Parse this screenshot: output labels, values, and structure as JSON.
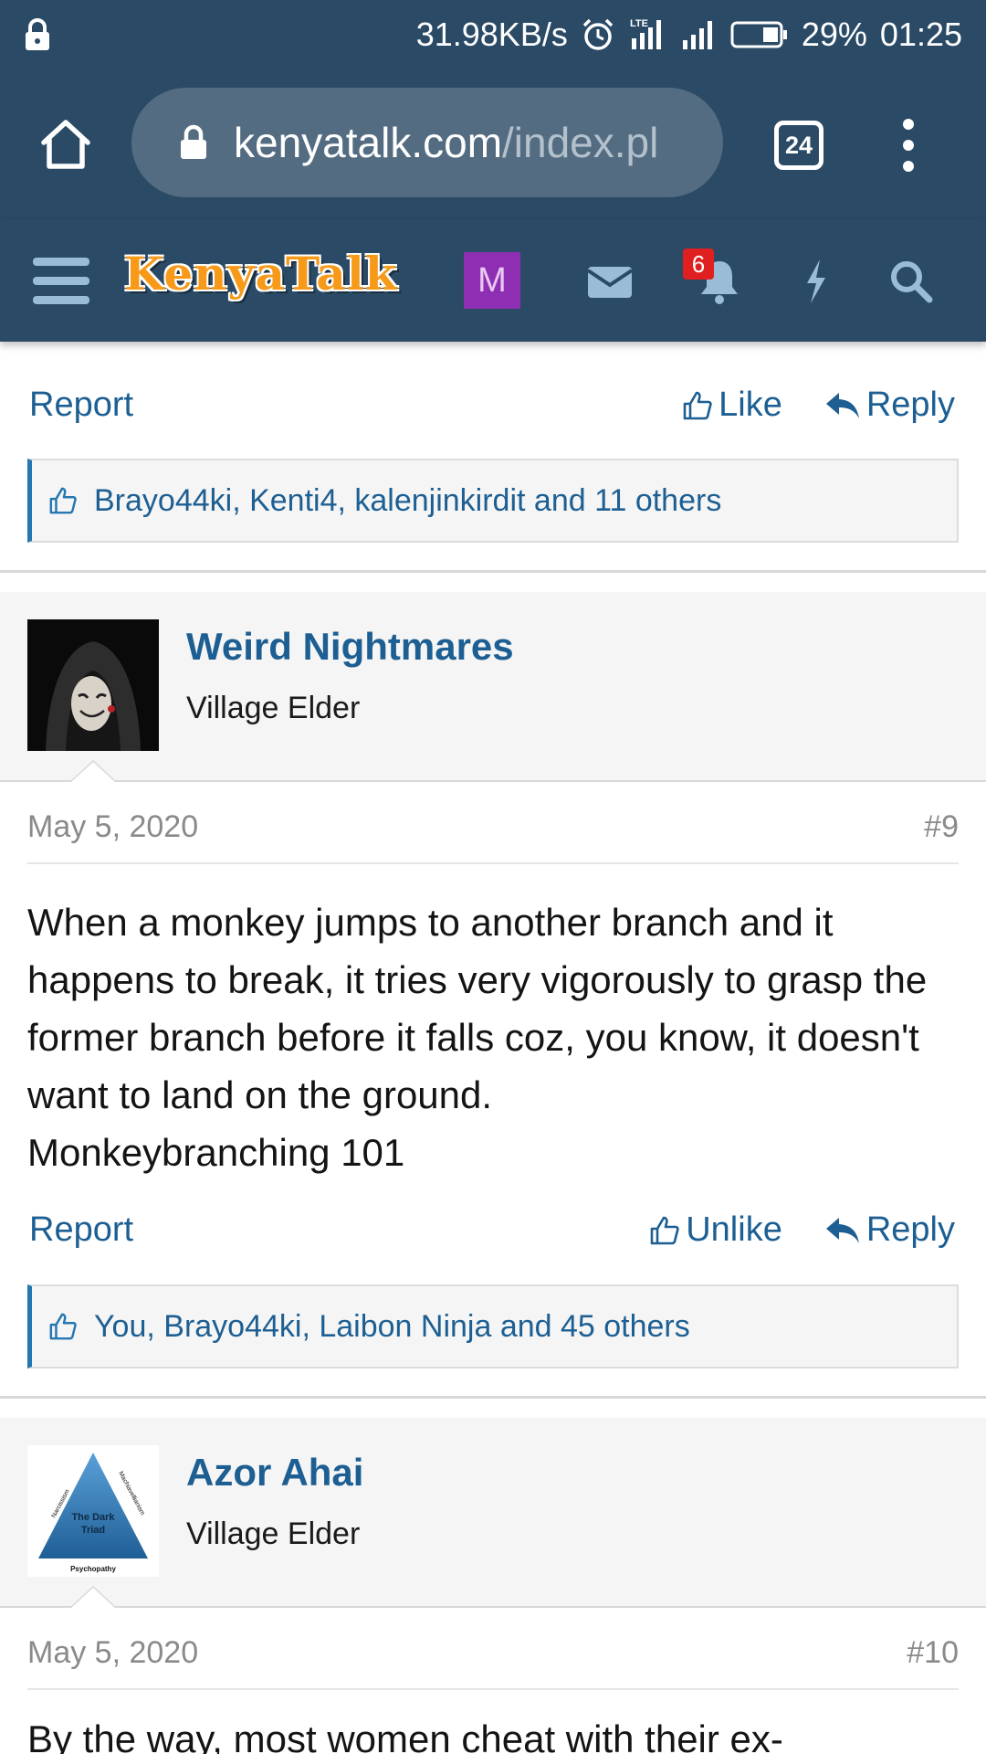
{
  "status_bar": {
    "speed": "31.98KB/s",
    "network": "LTE",
    "battery": "29%",
    "time": "01:25"
  },
  "browser": {
    "url_host": "kenyatalk.com",
    "url_path": "/index.pl",
    "tab_count": "24"
  },
  "site_nav": {
    "logo": "KenyaTalk",
    "avatar_letter": "M",
    "notification_count": "6"
  },
  "post_8_footer": {
    "report": "Report",
    "like": "Like",
    "reply": "Reply",
    "likes_text": "Brayo44ki, Kenti4, kalenjinkirdit and 11 others"
  },
  "post_9": {
    "username": "Weird Nightmares",
    "user_title": "Village Elder",
    "date": "May 5, 2020",
    "number": "#9",
    "body": "When a monkey jumps to another branch and it happens to break, it tries very vigorously to grasp the former branch before it falls coz, you know, it doesn't want to land on the ground.",
    "body2": "Monkeybranching 101",
    "report": "Report",
    "like": "Unlike",
    "reply": "Reply",
    "likes_text": "You, Brayo44ki, Laibon Ninja and 45 others"
  },
  "post_10": {
    "username": "Azor Ahai",
    "user_title": "Village Elder",
    "avatar_labels": [
      "Narcissism",
      "Machiavellianism",
      "The Dark Triad",
      "Psychopathy"
    ],
    "date": "May 5, 2020",
    "number": "#10",
    "body": "By the way, most women cheat with their ex-"
  }
}
